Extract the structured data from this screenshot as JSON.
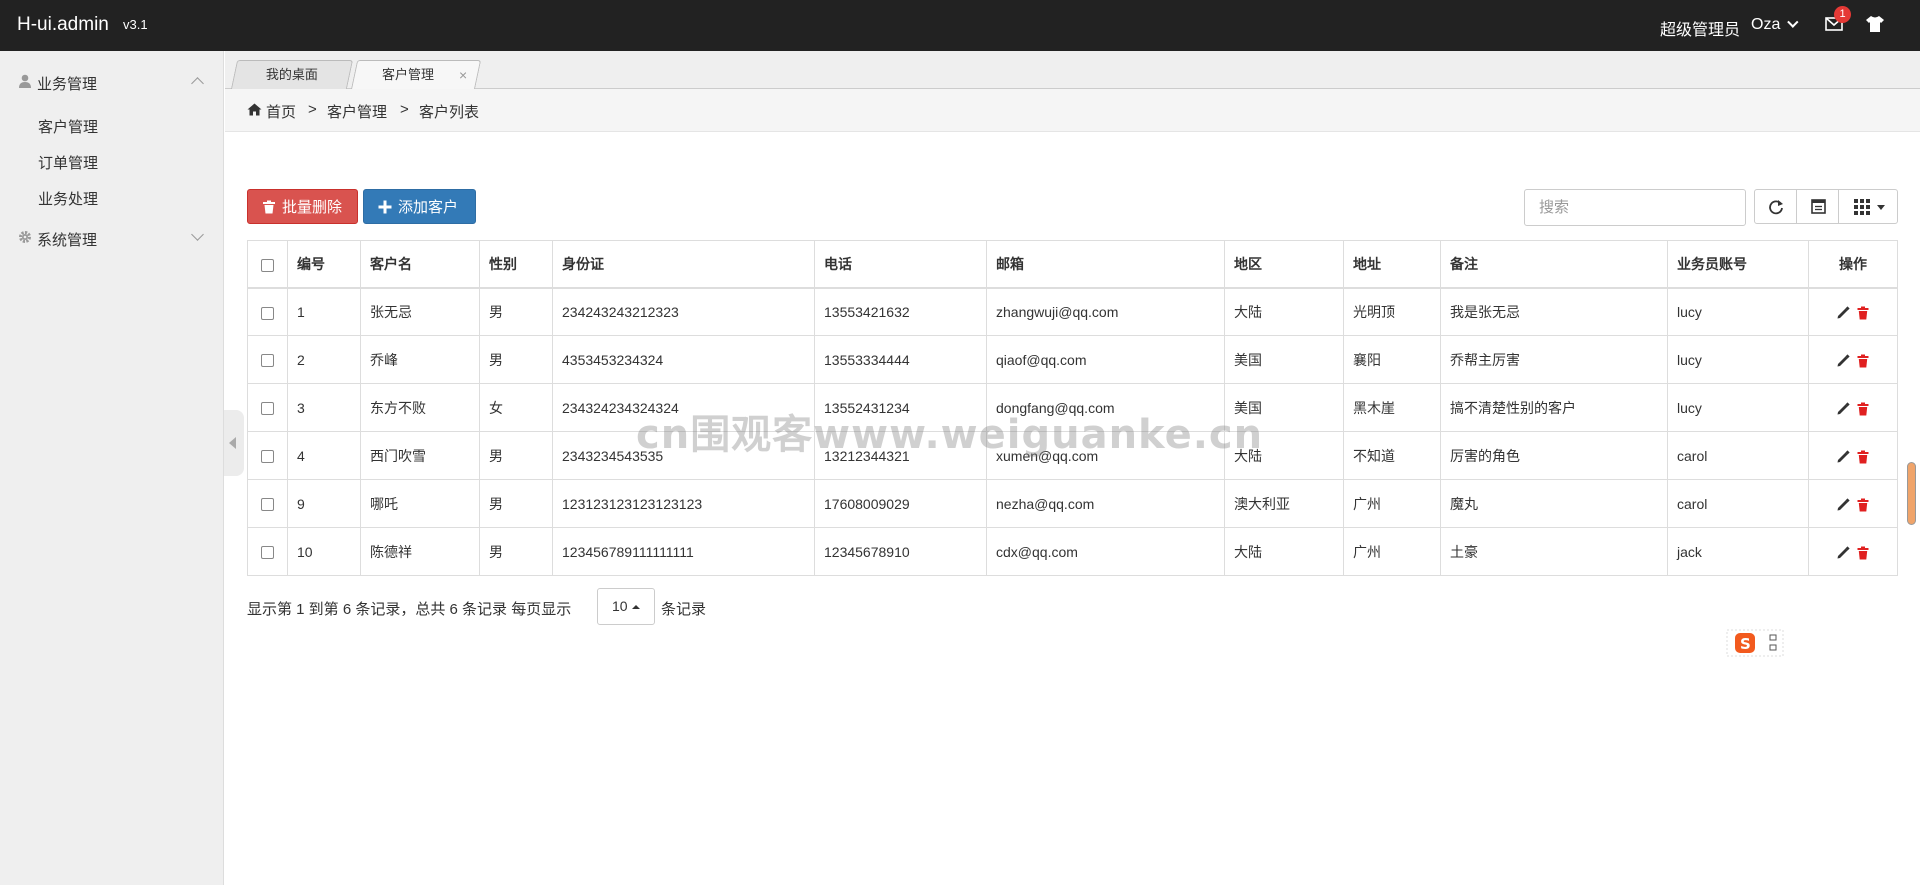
{
  "app": {
    "brand": "H-ui.admin",
    "version": "v3.1"
  },
  "topbar": {
    "role": "超级管理员",
    "user": "Oza",
    "mail_badge": "1"
  },
  "sidebar": {
    "groups": [
      {
        "label": "业务管理",
        "icon": "user-icon",
        "expanded": true,
        "items": [
          "客户管理",
          "订单管理",
          "业务处理"
        ]
      },
      {
        "label": "系统管理",
        "icon": "gear-icon",
        "expanded": false
      }
    ]
  },
  "tabs": [
    {
      "label": "我的桌面",
      "active": false
    },
    {
      "label": "客户管理",
      "active": true,
      "close": "×"
    }
  ],
  "breadcrumb": {
    "home": "首页",
    "sep": ">",
    "level1": "客户管理",
    "level2": "客户列表"
  },
  "toolbar": {
    "batch_delete": "批量删除",
    "add_customer": "添加客户",
    "search_placeholder": "搜索"
  },
  "table": {
    "columns": [
      "编号",
      "客户名",
      "性别",
      "身份证",
      "电话",
      "邮箱",
      "地区",
      "地址",
      "备注",
      "业务员账号",
      "操作"
    ],
    "rows": [
      {
        "id": "1",
        "name": "张无忌",
        "gender": "男",
        "idcard": "234243243212323",
        "phone": "13553421632",
        "email": "zhangwuji@qq.com",
        "region": "大陆",
        "address": "光明顶",
        "note": "我是张无忌",
        "sales": "lucy"
      },
      {
        "id": "2",
        "name": "乔峰",
        "gender": "男",
        "idcard": "4353453234324",
        "phone": "13553334444",
        "email": "qiaof@qq.com",
        "region": "美国",
        "address": "襄阳",
        "note": "乔帮主厉害",
        "sales": "lucy"
      },
      {
        "id": "3",
        "name": "东方不败",
        "gender": "女",
        "idcard": "234324234324324",
        "phone": "13552431234",
        "email": "dongfang@qq.com",
        "region": "美国",
        "address": "黑木崖",
        "note": "搞不清楚性别的客户",
        "sales": "lucy"
      },
      {
        "id": "4",
        "name": "西门吹雪",
        "gender": "男",
        "idcard": "2343234543535",
        "phone": "13212344321",
        "email": "xumen@qq.com",
        "region": "大陆",
        "address": "不知道",
        "note": "厉害的角色",
        "sales": "carol"
      },
      {
        "id": "9",
        "name": "哪吒",
        "gender": "男",
        "idcard": "123123123123123123",
        "phone": "17608009029",
        "email": "nezha@qq.com",
        "region": "澳大利亚",
        "address": "广州",
        "note": "魔丸",
        "sales": "carol"
      },
      {
        "id": "10",
        "name": "陈德祥",
        "gender": "男",
        "idcard": "123456789111111111",
        "phone": "12345678910",
        "email": "cdx@qq.com",
        "region": "大陆",
        "address": "广州",
        "note": "土豪",
        "sales": "jack"
      }
    ]
  },
  "pagination": {
    "summary": "显示第 1 到第 6 条记录，总共 6 条记录  每页显示",
    "page_size": "10",
    "suffix": "条记录"
  },
  "watermark": "cn围观客www.weiguanke.cn",
  "colors": {
    "topbar": "#222222",
    "danger": "#d9534f",
    "primary": "#337ab7",
    "delete_icon": "#e02020"
  }
}
